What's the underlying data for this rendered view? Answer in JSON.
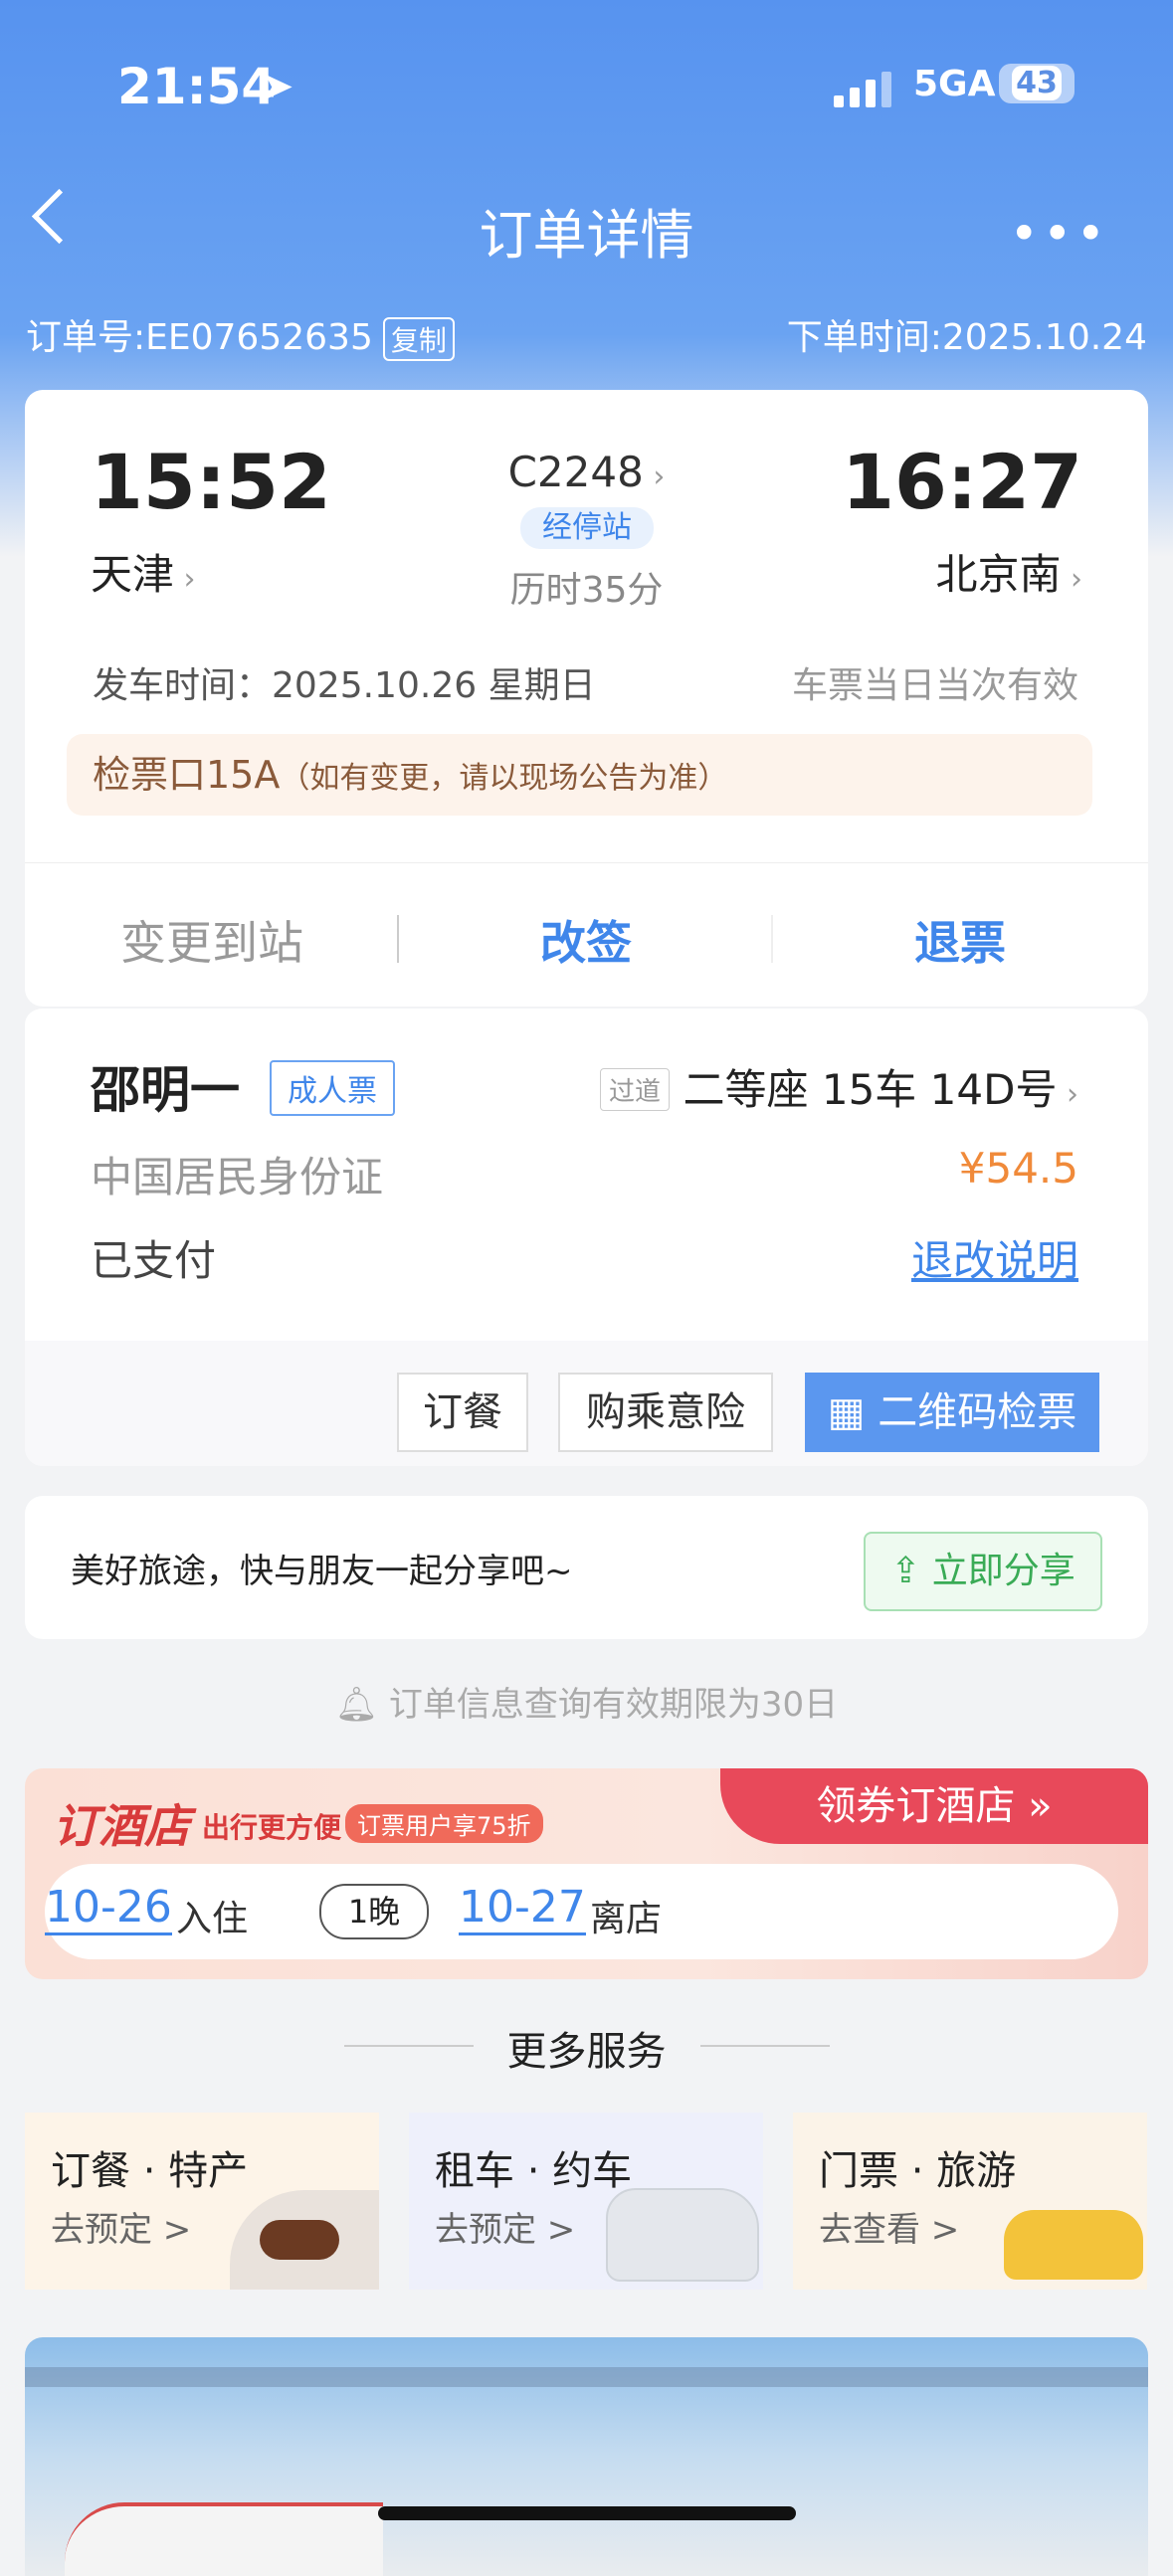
{
  "status_bar": {
    "time": "21:54",
    "network": "5GA",
    "battery": "43"
  },
  "nav": {
    "title": "订单详情",
    "more": "•••"
  },
  "order": {
    "number": "订单号:EE07652635",
    "copy": "复制",
    "time": "下单时间:2025.10.24"
  },
  "trip": {
    "depart_time": "15:52",
    "arrive_time": "16:27",
    "depart_station": "天津",
    "arrive_station": "北京南",
    "train_no": "C2248",
    "stops": "经停站",
    "duration": "历时35分",
    "date": "发车时间：2025.10.26 星期日",
    "validity": "车票当日当次有效",
    "gate": "检票口15A",
    "gate_note": "（如有变更，请以现场公告为准）"
  },
  "actions": {
    "change_station": "变更到站",
    "reschedule": "改签",
    "refund": "退票"
  },
  "passenger": {
    "name": "邵明一",
    "ticket_type": "成人票",
    "seat_tag": "过道",
    "seat": "二等座 15车 14D号",
    "id_type": "中国居民身份证",
    "price": "¥54.5",
    "status": "已支付",
    "rules": "退改说明"
  },
  "passenger_buttons": {
    "meal": "订餐",
    "insurance": "购乘意险",
    "qr": "二维码检票"
  },
  "share": {
    "text": "美好旅途，快与朋友一起分享吧~",
    "button": "立即分享"
  },
  "notice": "订单信息查询有效期限为30日",
  "hotel": {
    "title": "订酒店",
    "subtitle": "出行更方便",
    "tag": "订票用户享75折",
    "cta": "领券订酒店 »",
    "checkin_date": "10-26",
    "checkin_label": "入住",
    "nights": "1晚",
    "checkout_date": "10-27",
    "checkout_label": "离店"
  },
  "more_services": {
    "title": "更多服务",
    "items": [
      {
        "title": "订餐 · 特产",
        "sub": "去预定 >"
      },
      {
        "title": "租车 · 约车",
        "sub": "去预定 >"
      },
      {
        "title": "门票 · 旅游",
        "sub": "去查看 >"
      }
    ]
  },
  "colors": {
    "primary": "#3f86ea",
    "price": "#f08a3a",
    "hotel_red": "#d83b3b"
  }
}
